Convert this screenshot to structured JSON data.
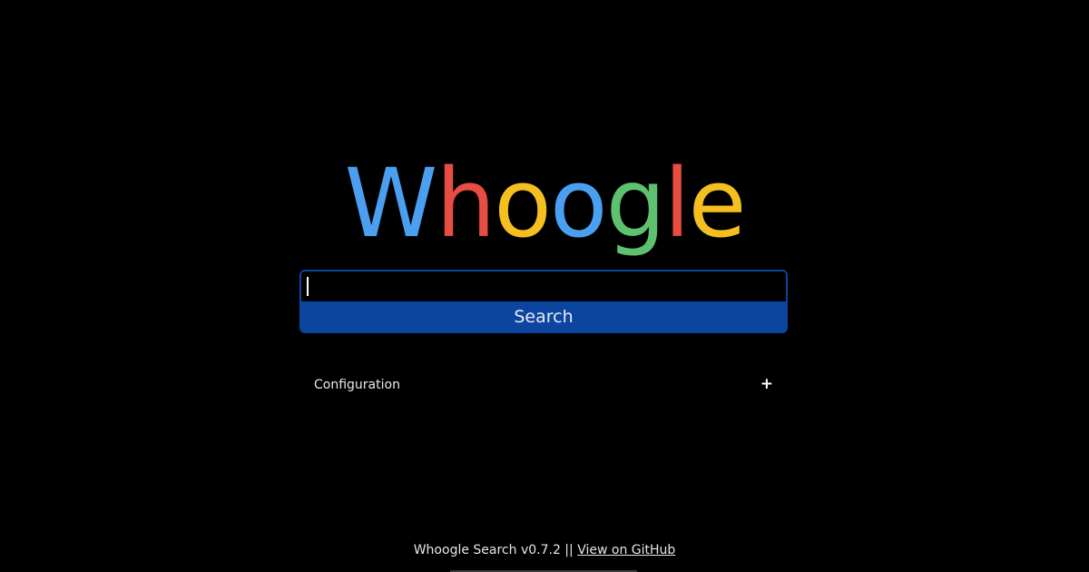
{
  "logo": {
    "letters": [
      {
        "char": "W",
        "color": "#4a9ff1"
      },
      {
        "char": "h",
        "color": "#e84d44"
      },
      {
        "char": "o",
        "color": "#f5bf1f"
      },
      {
        "char": "o",
        "color": "#4a9ff1"
      },
      {
        "char": "g",
        "color": "#5ec16f"
      },
      {
        "char": "l",
        "color": "#e84d44"
      },
      {
        "char": "e",
        "color": "#f5bf1f"
      }
    ]
  },
  "search": {
    "value": "",
    "button_label": "Search",
    "accent_color": "#0b45a0"
  },
  "config": {
    "label": "Configuration",
    "toggle": "+"
  },
  "footer": {
    "text": "Whoogle Search v0.7.2 || ",
    "link_label": "View on GitHub"
  },
  "colors": {
    "background": "#000000",
    "text": "#e6e6e6"
  }
}
